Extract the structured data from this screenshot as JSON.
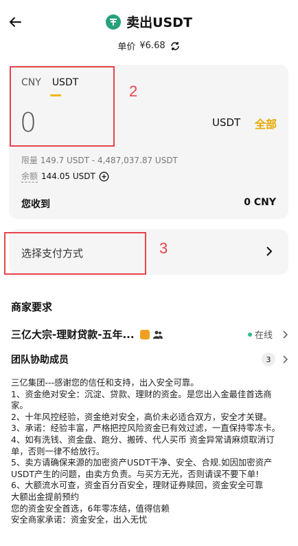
{
  "header": {
    "title": "卖出USDT",
    "price_label": "单价",
    "price_value": "¥6.68"
  },
  "amount_card": {
    "tabs": [
      "CNY",
      "USDT"
    ],
    "active_tab": "USDT",
    "amount": "0",
    "unit": "USDT",
    "all_label": "全部",
    "limit_label": "限量",
    "limit_value": "149.7 USDT - 4,487,037.87 USDT",
    "balance_label": "余额",
    "balance_value": "144.05 USDT",
    "receive_label": "您收到",
    "receive_value": "0 CNY"
  },
  "payment": {
    "label": "选择支付方式"
  },
  "annotations": {
    "box2_label": "2",
    "box3_label": "3"
  },
  "merchant": {
    "section_title": "商家要求",
    "name": "三亿大宗-理财贷款-五年...",
    "status": "在线",
    "team_label": "团队协助成员",
    "team_count": "3"
  },
  "terms": [
    "三亿集团---感谢您的信任和支持，出入安全可靠。",
    "1、资金绝对安全：沉淀、贷款、理财的资金。是您出入金最佳首选商家。",
    "2、十年风控经验，资金绝对安全，高价未必适合双方，安全才关键。",
    "3、承诺：经验丰富，严格把控风险资金已有效过滤，一直保持零冻卡。",
    "4、如有洗钱、资金盘、跑分、搬砖、代人买币 资金异常请麻烦取消订单，否则一律不给放行。",
    "5、卖方请确保来源的加密资产USDT干净、安全、合规.如因加密资产USDT产生的问题，由卖方负责。与买方无光，否则请误不要下单!",
    "6、大额流水可查，资金百分百安全，理财证券赎回，资金安全可靠",
    "大额出金提前预约",
    "您的资金安全首选，6年零冻结，值得信赖",
    "安全商家承诺：资金安全，出入无忧"
  ],
  "colors": {
    "accent": "#f0b90b",
    "annotation": "#e8424b",
    "online": "#2ebd85",
    "tether": "#26a17b"
  }
}
